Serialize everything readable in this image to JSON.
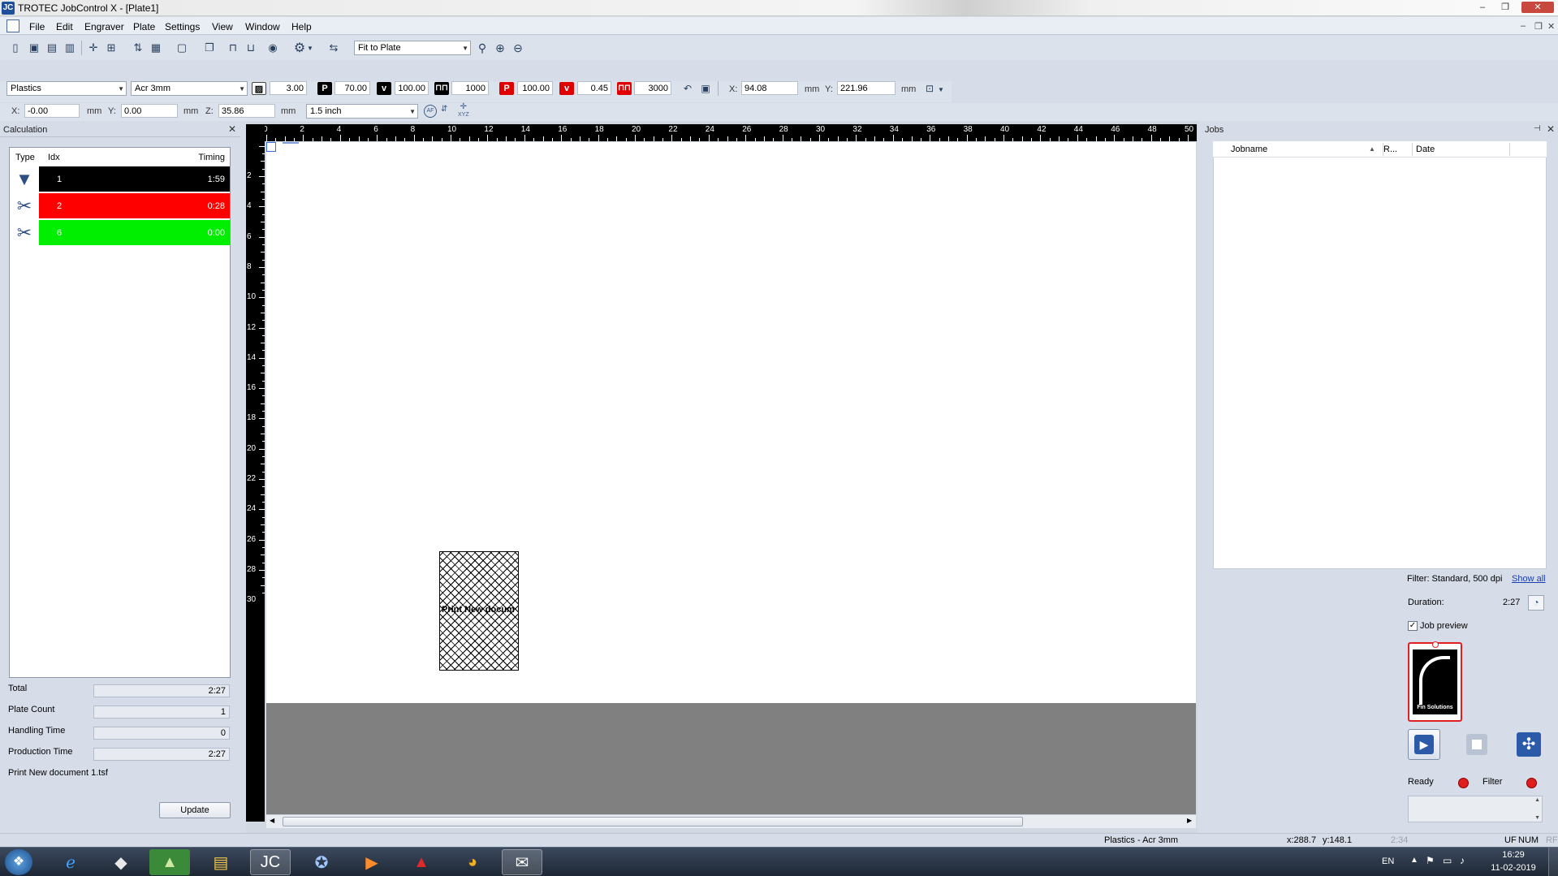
{
  "window": {
    "title": "TROTEC JobControl X - [Plate1]",
    "logo_text": "JC",
    "minimize": "–",
    "maximize": "❐",
    "close": "✕"
  },
  "menu": [
    "File",
    "Edit",
    "Engraver",
    "Plate",
    "Settings",
    "View",
    "Window",
    "Help"
  ],
  "toolbar": {
    "zoom_mode": "Fit to Plate"
  },
  "params": {
    "material_group": "Plastics",
    "material": "Acr 3mm",
    "thickness": "3.00",
    "engrave_power_label": "P",
    "engrave_power": "70.00",
    "engrave_speed_label": "v",
    "engrave_speed": "100.00",
    "engrave_ppi": "1000",
    "cut_power_label": "P",
    "cut_power": "100.00",
    "cut_speed_label": "v",
    "cut_speed": "0.45",
    "cut_freq": "3000",
    "x_label": "X:",
    "x_value": "94.08",
    "x_unit": "mm",
    "y_label": "Y:",
    "y_value": "221.96",
    "y_unit": "mm"
  },
  "coords": {
    "x_label": "X:",
    "x_value": "-0.00",
    "x_unit": "mm",
    "y_label": "Y:",
    "y_value": "0.00",
    "y_unit": "mm",
    "z_label": "Z:",
    "z_value": "35.86",
    "z_unit": "mm",
    "lens": "1.5 inch",
    "af_label": "AF",
    "xyz_label": "XYZ"
  },
  "calculation": {
    "title": "Calculation",
    "columns": {
      "type": "Type",
      "idx": "Idx",
      "timing": "Timing"
    },
    "rows": [
      {
        "idx": "1",
        "timing": "1:59",
        "color": "#000000",
        "type_icon": "engrave-icon"
      },
      {
        "idx": "2",
        "timing": "0:28",
        "color": "#ff0000",
        "type_icon": "cut-icon"
      },
      {
        "idx": "6",
        "timing": "0:00",
        "color": "#00ee00",
        "type_icon": "cut-icon"
      }
    ],
    "summary": {
      "total_label": "Total",
      "total": "2:27",
      "plate_count_label": "Plate Count",
      "plate_count": "1",
      "handling_label": "Handling Time",
      "handling": "0",
      "production_label": "Production Time",
      "production": "2:27"
    },
    "filename": "Print New document 1.tsf",
    "update_label": "Update"
  },
  "ruler": {
    "top": [
      "0",
      "2",
      "4",
      "6",
      "8",
      "10",
      "12",
      "14",
      "16",
      "18",
      "20",
      "22",
      "24",
      "26",
      "28",
      "30",
      "32",
      "34",
      "36",
      "38",
      "40",
      "42",
      "44",
      "46",
      "48",
      "50"
    ],
    "left": [
      "2",
      "4",
      "6",
      "8",
      "10",
      "12",
      "14",
      "16",
      "18",
      "20",
      "22",
      "24",
      "26",
      "28",
      "30"
    ]
  },
  "job_on_plate": {
    "label": "Print New docum"
  },
  "jobs": {
    "title": "Jobs",
    "columns": {
      "jobname": "Jobname",
      "r": "R...",
      "date": "Date"
    },
    "filter_text": "Filter: Standard, 500 dpi",
    "show_all": "Show all",
    "duration_label": "Duration:",
    "duration": "2:27",
    "job_preview_label": "Job preview",
    "preview_logo_text": "Fin Solutions",
    "ready_label": "Ready",
    "filter_label": "Filter"
  },
  "status": {
    "material": "Plastics - Acr 3mm",
    "cursor_x": "x:288.7",
    "cursor_y": "y:148.1",
    "time": "2:34",
    "uf": "UF",
    "num": "NUM",
    "rf": "RF"
  },
  "taskbar": {
    "lang": "EN",
    "clock_time": "16:29",
    "clock_date": "11-02-2019"
  }
}
